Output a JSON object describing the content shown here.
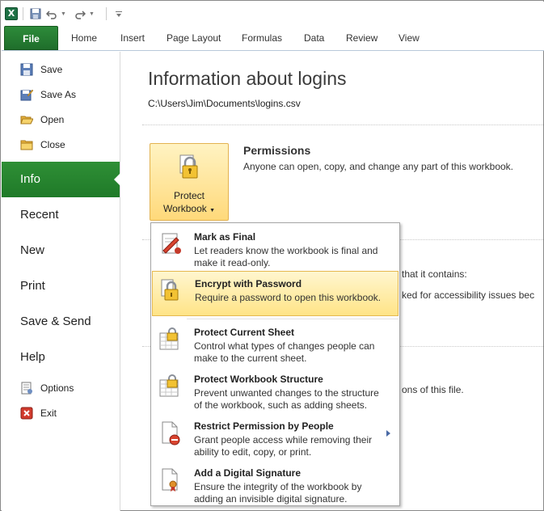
{
  "qat": {
    "app_icon": "X",
    "icons": [
      "excel-icon",
      "save-icon",
      "undo-icon",
      "redo-icon",
      "customize-icon"
    ]
  },
  "ribbon": {
    "file_tab": "File",
    "tabs": [
      "Home",
      "Insert",
      "Page Layout",
      "Formulas",
      "Data",
      "Review",
      "View"
    ]
  },
  "nav": {
    "save": "Save",
    "save_as": "Save As",
    "open": "Open",
    "close": "Close",
    "info": "Info",
    "recent": "Recent",
    "new": "New",
    "print": "Print",
    "save_send": "Save & Send",
    "help": "Help",
    "options": "Options",
    "exit": "Exit"
  },
  "info": {
    "title": "Information about logins",
    "path": "C:\\Users\\Jim\\Documents\\logins.csv",
    "protect_label_1": "Protect",
    "protect_label_2": "Workbook",
    "permissions_title": "Permissions",
    "permissions_desc": "Anyone can open, copy, and change any part of this workbook.",
    "behind_1": "that it contains:",
    "behind_2": "ked for accessibility issues bec",
    "behind_3": "ons of this file."
  },
  "menu": {
    "items": [
      {
        "title": "Mark as Final",
        "desc": "Let readers know the workbook is final and make it read-only."
      },
      {
        "title": "Encrypt with Password",
        "desc": "Require a password to open this workbook."
      },
      {
        "title": "Protect Current Sheet",
        "desc": "Control what types of changes people can make to the current sheet."
      },
      {
        "title": "Protect Workbook Structure",
        "desc": "Prevent unwanted changes to the structure of the workbook, such as adding sheets."
      },
      {
        "title": "Restrict Permission by People",
        "desc": "Grant people access while removing their ability to edit, copy, or print."
      },
      {
        "title": "Add a Digital Signature",
        "desc": "Ensure the integrity of the workbook by adding an invisible digital signature."
      }
    ]
  },
  "colors": {
    "file_green": "#2d8b3a",
    "highlight": "#ffe487",
    "accent_blue": "#4a6aa5"
  }
}
